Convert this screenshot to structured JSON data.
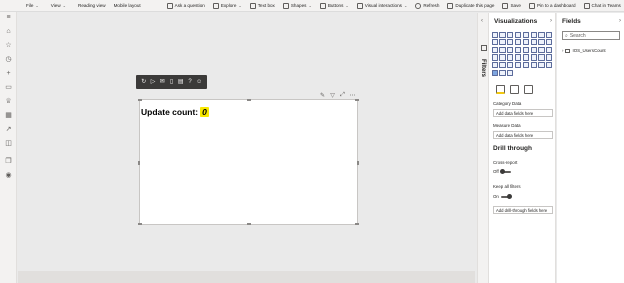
{
  "ribbon": {
    "items": [
      {
        "label": "File",
        "chevron": true,
        "icon": "none"
      },
      {
        "label": "View",
        "chevron": true,
        "icon": "none"
      },
      {
        "label": "Reading view",
        "chevron": false,
        "icon": "none"
      },
      {
        "label": "Mobile layout",
        "chevron": false,
        "icon": "none"
      },
      {
        "label": "Ask a question",
        "chevron": false,
        "icon": "chat-question-icon"
      },
      {
        "label": "Explore",
        "chevron": true,
        "icon": "explore-icon"
      },
      {
        "label": "Text box",
        "chevron": false,
        "icon": "textbox-icon"
      },
      {
        "label": "Shapes",
        "chevron": true,
        "icon": "shapes-icon"
      },
      {
        "label": "Buttons",
        "chevron": true,
        "icon": "buttons-icon"
      },
      {
        "label": "Visual interactions",
        "chevron": true,
        "icon": "interactions-icon"
      },
      {
        "label": "Refresh",
        "chevron": false,
        "icon": "refresh-icon"
      },
      {
        "label": "Duplicate this page",
        "chevron": false,
        "icon": "duplicate-icon"
      },
      {
        "label": "Save",
        "chevron": false,
        "icon": "save-icon"
      },
      {
        "label": "Pin to a dashboard",
        "chevron": false,
        "icon": "pin-icon"
      },
      {
        "label": "Chat in Teams",
        "chevron": false,
        "icon": "teams-icon"
      }
    ]
  },
  "visual": {
    "label": "Update count:",
    "value": "0",
    "highlight_color": "#f8e800"
  },
  "filters": {
    "label": "Filters"
  },
  "visualizations": {
    "title": "Visualizations",
    "category_label": "Category Data",
    "category_placeholder": "Add data fields here",
    "measure_label": "Measure Data",
    "measure_placeholder": "Add data fields here",
    "drill_title": "Drill through",
    "cross_report_label": "Cross-report",
    "cross_report_state": "Off",
    "keep_filters_label": "Keep all filters",
    "keep_filters_state": "On",
    "drill_placeholder": "Add drill-through fields here"
  },
  "fields": {
    "title": "Fields",
    "search_placeholder": "Search",
    "table_name": "IOS_UsersCount"
  },
  "colors": {
    "accent": "#f2c811",
    "toolbar_bg": "#3b3a39"
  }
}
